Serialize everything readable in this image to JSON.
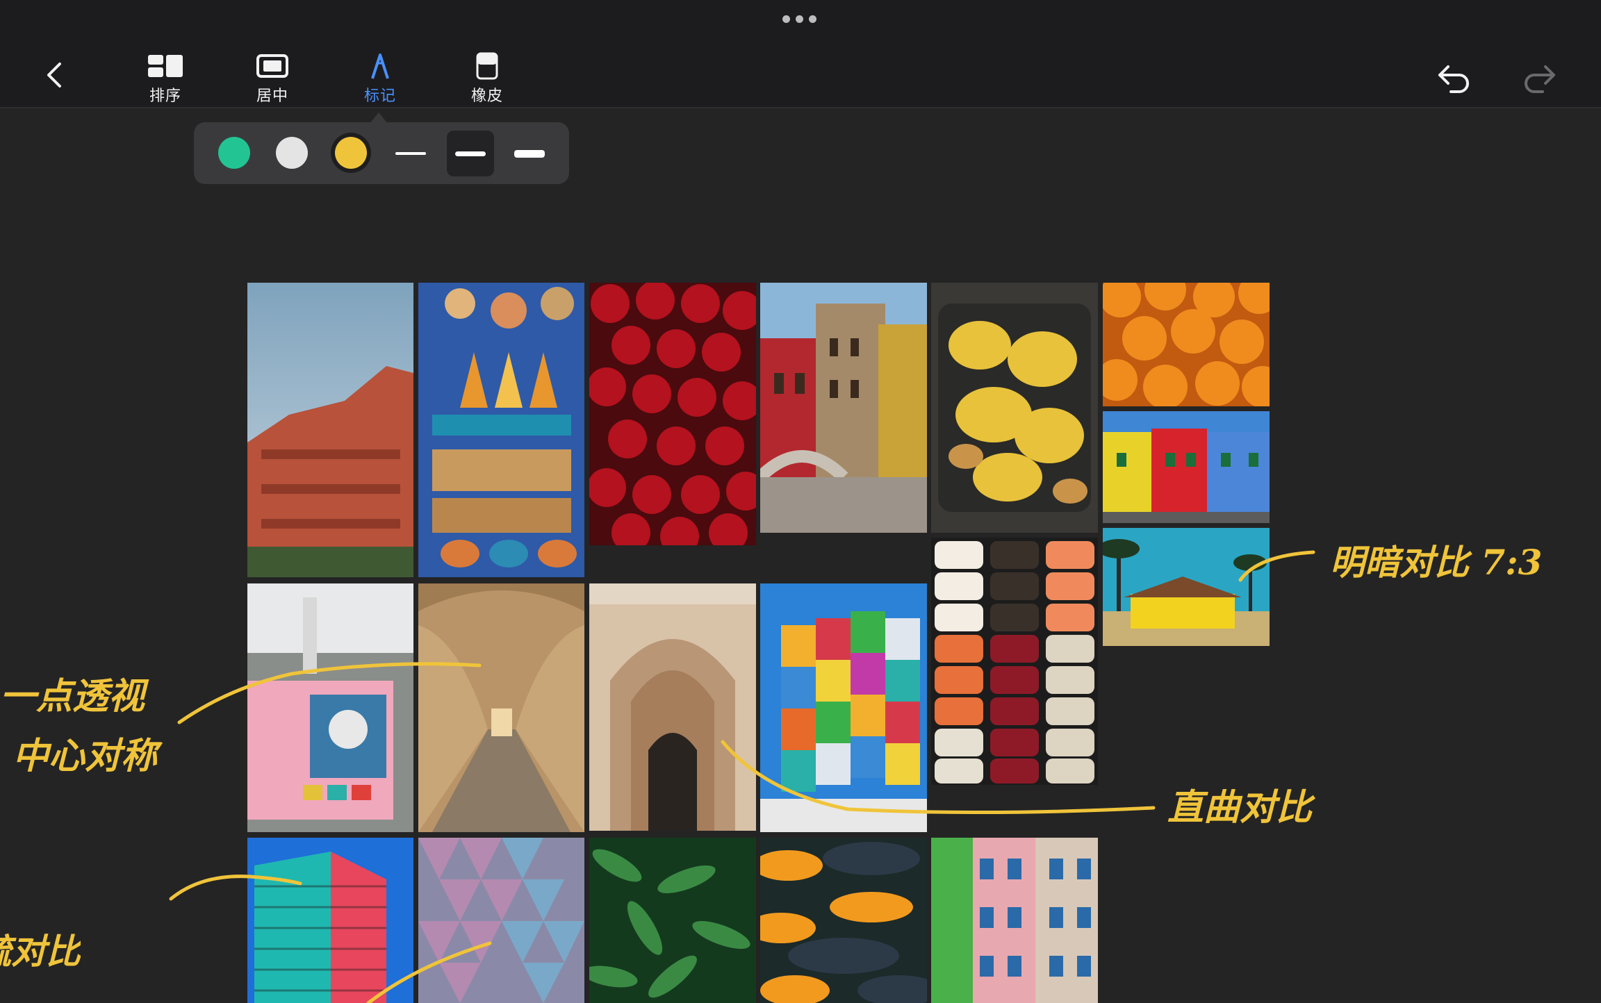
{
  "toolbar": {
    "tools": [
      {
        "label": "排序",
        "icon": "arrange-icon"
      },
      {
        "label": "居中",
        "icon": "center-icon"
      },
      {
        "label": "标记",
        "icon": "markup-pen-icon",
        "active": true
      },
      {
        "label": "橡皮",
        "icon": "eraser-icon"
      }
    ],
    "active_color": "#4a90ff"
  },
  "palette": {
    "colors": [
      "#22c493",
      "#e4e4e4",
      "#f0c43a"
    ],
    "selected_color": "#f0c43a",
    "stroke_widths": [
      "thin",
      "medium",
      "thick"
    ],
    "selected_stroke": "medium"
  },
  "photos": [
    {
      "name": "red-apartment-building"
    },
    {
      "name": "moroccan-market-stall"
    },
    {
      "name": "red-cherries"
    },
    {
      "name": "venice-canal-houses"
    },
    {
      "name": "yellow-sauce-dish"
    },
    {
      "name": "oranges-pile"
    },
    {
      "name": "colorful-row-houses"
    },
    {
      "name": "yellow-house-palm-trees"
    },
    {
      "name": "sushi-rows"
    },
    {
      "name": "pink-kiosk-hello-jeju"
    },
    {
      "name": "arched-corridor"
    },
    {
      "name": "mosque-archway-door"
    },
    {
      "name": "colorful-glass-cube"
    },
    {
      "name": "teal-red-skyscraper"
    },
    {
      "name": "triangle-facade"
    },
    {
      "name": "green-leaves"
    },
    {
      "name": "eggplants-and-squash"
    },
    {
      "name": "colorful-balconies"
    }
  ],
  "annotations": {
    "note_contrast": "明暗对比 7:3",
    "note_perspective_1": "一点透视",
    "note_perspective_2": "中心对称",
    "note_curve": "直曲对比",
    "note_partial": "疏对比",
    "ink_color": "#f0c43a"
  }
}
